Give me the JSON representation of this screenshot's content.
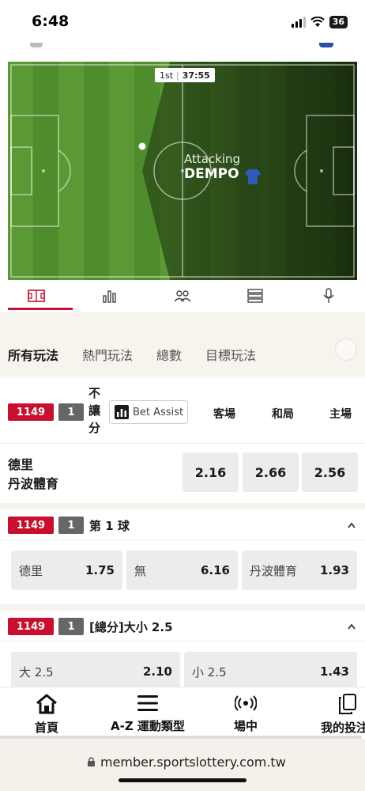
{
  "status": {
    "time": "6:48",
    "battery": "36"
  },
  "pitch": {
    "period": "1st",
    "clock": "37:55",
    "attacking_label": "Attacking",
    "attacking_team": "DEMPO"
  },
  "pitch_tabs": [
    "pitch-icon",
    "stats-icon",
    "lineup-icon",
    "list-icon",
    "mic-icon"
  ],
  "category_tabs": [
    "所有玩法",
    "熱門玩法",
    "總數",
    "目標玩法"
  ],
  "market1": {
    "id": "1149",
    "num": "1",
    "title_chars": [
      "不",
      "讓",
      "分"
    ],
    "bet_assist": "Bet Assist",
    "cols": [
      "客場",
      "和局",
      "主場"
    ],
    "team_away": "德里",
    "team_home": "丹波體育",
    "odds": [
      "2.16",
      "2.66",
      "2.56"
    ]
  },
  "market2": {
    "id": "1149",
    "num": "1",
    "title": "第 1 球",
    "options": [
      {
        "name": "德里",
        "odd": "1.75"
      },
      {
        "name": "無",
        "odd": "6.16"
      },
      {
        "name": "丹波體育",
        "odd": "1.93"
      }
    ]
  },
  "market3": {
    "id": "1149",
    "num": "1",
    "title": "[總分]大小 2.5",
    "options": [
      {
        "name": "大 2.5",
        "odd": "2.10"
      },
      {
        "name": "小 2.5",
        "odd": "1.43"
      }
    ]
  },
  "nav": [
    {
      "label": "首頁",
      "icon": "home-icon"
    },
    {
      "label": "A-Z 運動類型",
      "icon": "menu-icon"
    },
    {
      "label": "場中",
      "icon": "live-icon"
    },
    {
      "label": "我的投注",
      "icon": "bets-icon"
    }
  ],
  "url": "member.sportslottery.com.tw",
  "colors": {
    "accent": "#c8102e",
    "pitch_green": "#4f8c2c",
    "badge_gray": "#666666"
  }
}
